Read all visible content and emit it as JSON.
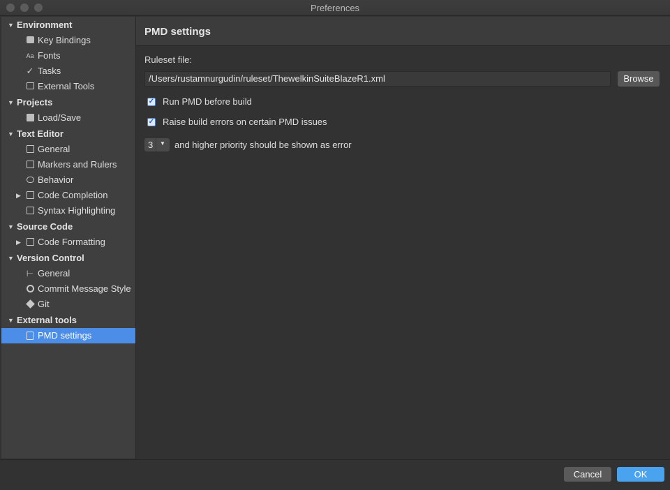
{
  "window": {
    "title": "Preferences"
  },
  "sidebar": {
    "groups": [
      {
        "label": "Environment",
        "items": [
          {
            "label": "Key Bindings",
            "icon": "keyboard-icon"
          },
          {
            "label": "Fonts",
            "icon": "fonts-icon",
            "glyph": "Aa"
          },
          {
            "label": "Tasks",
            "icon": "checkmark-icon",
            "glyph": "✓"
          },
          {
            "label": "External Tools",
            "icon": "terminal-icon"
          }
        ]
      },
      {
        "label": "Projects",
        "items": [
          {
            "label": "Load/Save",
            "icon": "book-icon"
          }
        ]
      },
      {
        "label": "Text Editor",
        "items": [
          {
            "label": "General",
            "icon": "pencil-icon"
          },
          {
            "label": "Markers and Rulers",
            "icon": "grid-icon"
          },
          {
            "label": "Behavior",
            "icon": "brain-icon"
          },
          {
            "label": "Code Completion",
            "icon": "list-icon",
            "expandable": true
          },
          {
            "label": "Syntax Highlighting",
            "icon": "highlight-icon"
          }
        ]
      },
      {
        "label": "Source Code",
        "items": [
          {
            "label": "Code Formatting",
            "icon": "format-icon",
            "expandable": true
          }
        ]
      },
      {
        "label": "Version Control",
        "items": [
          {
            "label": "General",
            "icon": "branch-icon"
          },
          {
            "label": "Commit Message Style",
            "icon": "badge-check-icon"
          },
          {
            "label": "Git",
            "icon": "git-icon"
          }
        ]
      },
      {
        "label": "External tools",
        "items": [
          {
            "label": "PMD settings",
            "icon": "document-icon",
            "selected": true
          }
        ]
      }
    ]
  },
  "panel": {
    "title": "PMD settings",
    "ruleset_label": "Ruleset file:",
    "ruleset_path": "/Users/rustamnurgudin/ruleset/ThewelkinSuiteBlazeR1.xml",
    "browse_label": "Browse",
    "run_pmd": {
      "label": "Run PMD before build",
      "checked": true
    },
    "raise_errors": {
      "label": "Raise build errors on certain PMD issues",
      "checked": true
    },
    "priority": {
      "value": "3",
      "text": "and higher priority should be shown as error"
    }
  },
  "footer": {
    "cancel_label": "Cancel",
    "ok_label": "OK"
  },
  "colors": {
    "accent": "#4aa3ee",
    "selection": "#4c8de7"
  }
}
